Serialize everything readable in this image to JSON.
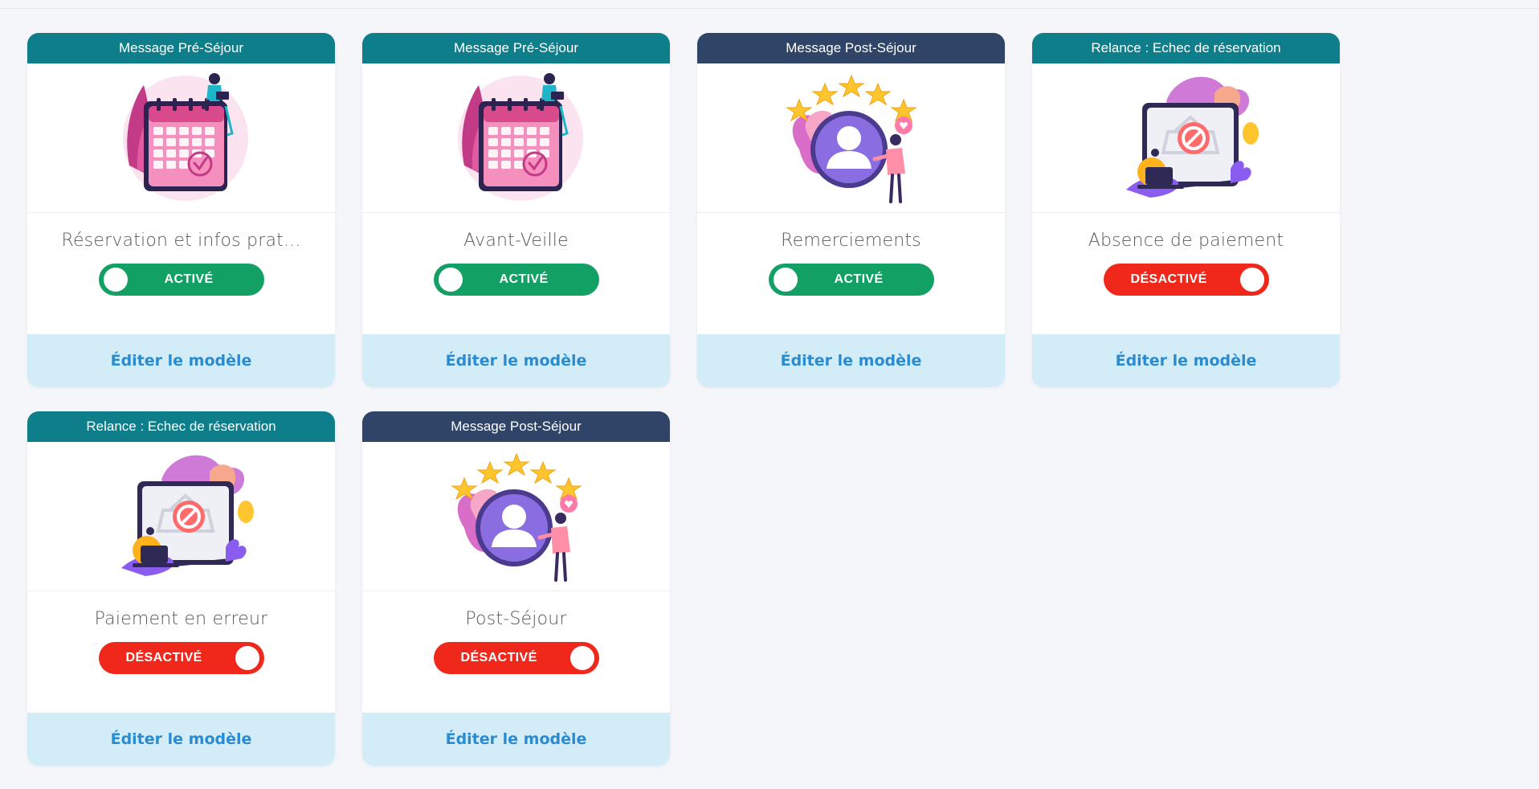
{
  "cards": [
    {
      "header": "Message Pré-Séjour",
      "header_style": "teal",
      "illustration": "calendar-illustration",
      "title": "Réservation et infos prat...",
      "toggle_state": "on",
      "toggle_label": "ACTIVÉ",
      "footer": "Éditer le modèle"
    },
    {
      "header": "Message Pré-Séjour",
      "header_style": "teal",
      "illustration": "calendar-illustration",
      "title": "Avant-Veille",
      "toggle_state": "on",
      "toggle_label": "ACTIVÉ",
      "footer": "Éditer le modèle"
    },
    {
      "header": "Message Post-Séjour",
      "header_style": "navy",
      "illustration": "review-stars-illustration",
      "title": "Remerciements",
      "toggle_state": "on",
      "toggle_label": "ACTIVÉ",
      "footer": "Éditer le modèle"
    },
    {
      "header": "Relance : Echec de réservation",
      "header_style": "teal",
      "illustration": "blocked-payment-illustration",
      "title": "Absence de paiement",
      "toggle_state": "off",
      "toggle_label": "DÉSACTIVÉ",
      "footer": "Éditer le modèle"
    },
    {
      "header": "Relance : Echec de réservation",
      "header_style": "teal",
      "illustration": "blocked-payment-illustration",
      "title": "Paiement en erreur",
      "toggle_state": "off",
      "toggle_label": "DÉSACTIVÉ",
      "footer": "Éditer le modèle"
    },
    {
      "header": "Message Post-Séjour",
      "header_style": "navy",
      "illustration": "review-stars-illustration",
      "title": "Post-Séjour",
      "toggle_state": "off",
      "toggle_label": "DÉSACTIVÉ",
      "footer": "Éditer le modèle"
    }
  ],
  "colors": {
    "header_teal": "#0e7e8a",
    "header_navy": "#2f4466",
    "toggle_on": "#12a064",
    "toggle_off": "#f0281c",
    "footer_bg": "#d2ecf8",
    "footer_text": "#2b8bd0"
  }
}
